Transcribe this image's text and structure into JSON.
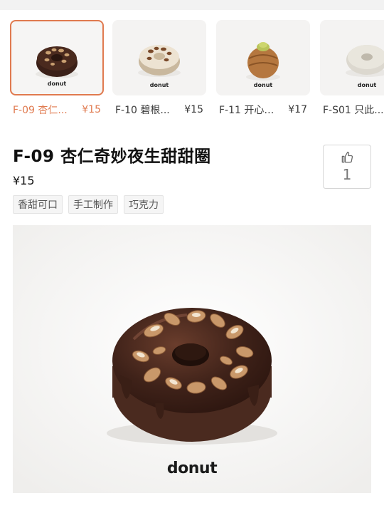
{
  "products": [
    {
      "name": "F-09 杏仁...",
      "price": "¥15",
      "brand": "donut",
      "selected": true,
      "icon": "chocolate-almond-donut"
    },
    {
      "name": "F-10 碧根...",
      "price": "¥15",
      "brand": "donut",
      "selected": false,
      "icon": "cream-pecan-donut"
    },
    {
      "name": "F-11 开心果...",
      "price": "¥17",
      "brand": "donut",
      "selected": false,
      "icon": "pistachio-cruller"
    },
    {
      "name": "F-S01 只此...",
      "price": "",
      "brand": "donut",
      "selected": false,
      "icon": "white-ring-donut"
    }
  ],
  "detail": {
    "title": "F-09 杏仁奇妙夜生甜甜圈",
    "price": "¥15",
    "likes": "1",
    "tags": [
      "香甜可口",
      "手工制作",
      "巧克力"
    ],
    "hero_brand": "donut"
  },
  "colors": {
    "accent": "#e07a4f",
    "chocolate": "#3b2018",
    "background": "#ffffff"
  }
}
